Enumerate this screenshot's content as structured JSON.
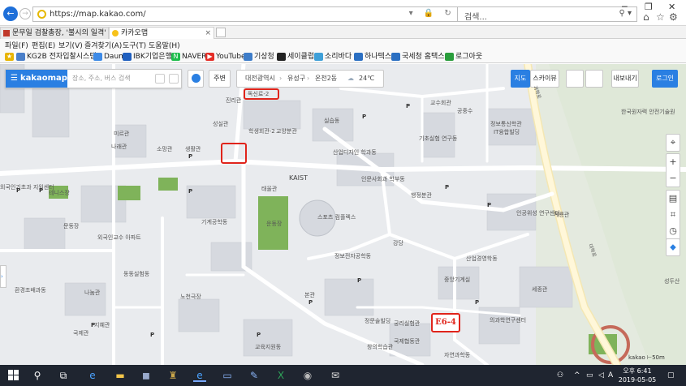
{
  "browser": {
    "url": "https://map.kakao.com/",
    "search_placeholder": "검색...",
    "tabs": [
      {
        "label": "문무일 검찰총장, '불시의 일격'",
        "favicon": "newspaper-icon"
      },
      {
        "label": "카카오맵",
        "favicon": "kakaomap-pin-icon"
      }
    ],
    "menu": [
      "파일(F)",
      "편집(E)",
      "보기(V)",
      "즐겨찾기(A)",
      "도구(T)",
      "도움말(H)"
    ],
    "favorites": [
      {
        "label": "KG2B 전자입찰시스템",
        "icon": "kg2b-icon",
        "color": "#4a7fc9"
      },
      {
        "label": "Daum",
        "icon": "daum-icon",
        "color": "#3d8ae6"
      },
      {
        "label": "IBK기업은행",
        "icon": "ibk-icon",
        "color": "#1f5fbf"
      },
      {
        "label": "NAVER",
        "icon": "naver-icon",
        "color": "#1fbd4c"
      },
      {
        "label": "YouTube",
        "icon": "youtube-icon",
        "color": "#e52d27"
      },
      {
        "label": "기상청",
        "icon": "kma-icon",
        "color": "#3e7dc9"
      },
      {
        "label": "세이클럽",
        "icon": "sayclub-icon",
        "color": "#222222"
      },
      {
        "label": "소리바다",
        "icon": "soribada-icon",
        "color": "#3fa0d8"
      },
      {
        "label": "하나텍스",
        "icon": "hanatax-icon",
        "color": "#2b6fc2"
      },
      {
        "label": "국세청 홈택스",
        "icon": "hometax-icon",
        "color": "#2b6fc2"
      },
      {
        "label": "로그아웃",
        "icon": "logout-icon",
        "color": "#2a9d3c"
      }
    ]
  },
  "kakaomap": {
    "brand": "kakaomap",
    "search_placeholder": "장소, 주소, 버스 검색",
    "nearby_label": "주변",
    "breadcrumb": [
      "대전광역시",
      "유성구",
      "온천2동"
    ],
    "weather": "24℃",
    "map_type_label": "지도",
    "skyview_label": "스카이뷰",
    "share_label": "내보내기",
    "login_label": "로그인",
    "brand_color": "#2a7fe2",
    "highlight_color": "#e0241b",
    "highlight_label": "E6-4",
    "scale_label": "50m",
    "map_logo": "kakao",
    "labels": [
      "독신료-2",
      "진리관",
      "성실관",
      "희망관",
      "혁신관",
      "교양분관",
      "학생회관-2",
      "실습동",
      "소망관",
      "사랑관",
      "생활관",
      "산업디자인 학과동",
      "인문사회과 학부동",
      "KAIST",
      "태울관",
      "운동장",
      "스포츠 컴플렉스",
      "기계공학동",
      "행정분관",
      "학생회관-1",
      "국제관",
      "미르관",
      "나래관",
      "외국인교수 아파트",
      "외국인기초과 지원센터",
      "테니스장",
      "문동장",
      "동동실험동",
      "나눔관",
      "환경조배과동",
      "노천극장",
      "지혜관",
      "본관",
      "정문술빌딩",
      "국제협동관",
      "창의학습관",
      "교육지원동",
      "궁리실험관",
      "자연과학동",
      "의과학연구센터",
      "산업경영학동",
      "세종관",
      "응용공학동",
      "중앙기계실",
      "중앙청사",
      "강당",
      "정보전자공학동",
      "공동실험동",
      "교수회관",
      "공중수",
      "정보통신학관",
      "IT융합빌딩",
      "기초실험 연구동",
      "한국원자력 안전기술원",
      "인공위성 연구센터",
      "계룡관",
      "성두산",
      "과학로",
      "대학로"
    ]
  },
  "taskbar": {
    "apps": [
      "search-icon",
      "task-view-icon",
      "edge-icon",
      "file-explorer-icon",
      "store-icon",
      "game-icon",
      "ie-icon",
      "notepad-icon",
      "paint-icon",
      "excel-icon",
      "media-icon",
      "mail-icon"
    ],
    "time": "오후 6:41",
    "date": "2019-05-05"
  }
}
